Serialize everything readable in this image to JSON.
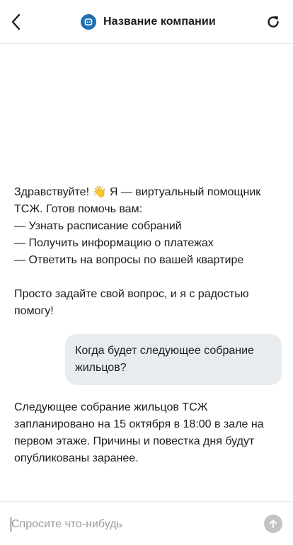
{
  "header": {
    "title": "Название компании",
    "back_icon": "chevron-left-icon",
    "logo_icon": "bot-icon",
    "refresh_icon": "refresh-icon"
  },
  "messages": {
    "bot_greeting": {
      "line1": "Здравствуйте! 👋 Я — виртуальный помощник ТСЖ. Готов помочь вам:",
      "line2": "— Узнать расписание собраний",
      "line3": "— Получить информацию о платежах",
      "line4": "— Ответить на вопросы по вашей квартире",
      "line5": "Просто задайте свой вопрос, и я с радостью помогу!"
    },
    "user_question": "Когда будет следующее собрание жильцов?",
    "bot_answer": "Следующее собрание жильцов ТСЖ запланировано на 15 октября в 18:00 в зале на первом этаже. Причины и повестка дня будут опубликованы заранее."
  },
  "composer": {
    "placeholder": "Спросите что-нибудь",
    "value": "",
    "send_icon": "arrow-up-icon"
  },
  "colors": {
    "logo": "#1e6fb0",
    "user_bubble": "#e9ecef",
    "send_button": "#c3c3c6"
  }
}
